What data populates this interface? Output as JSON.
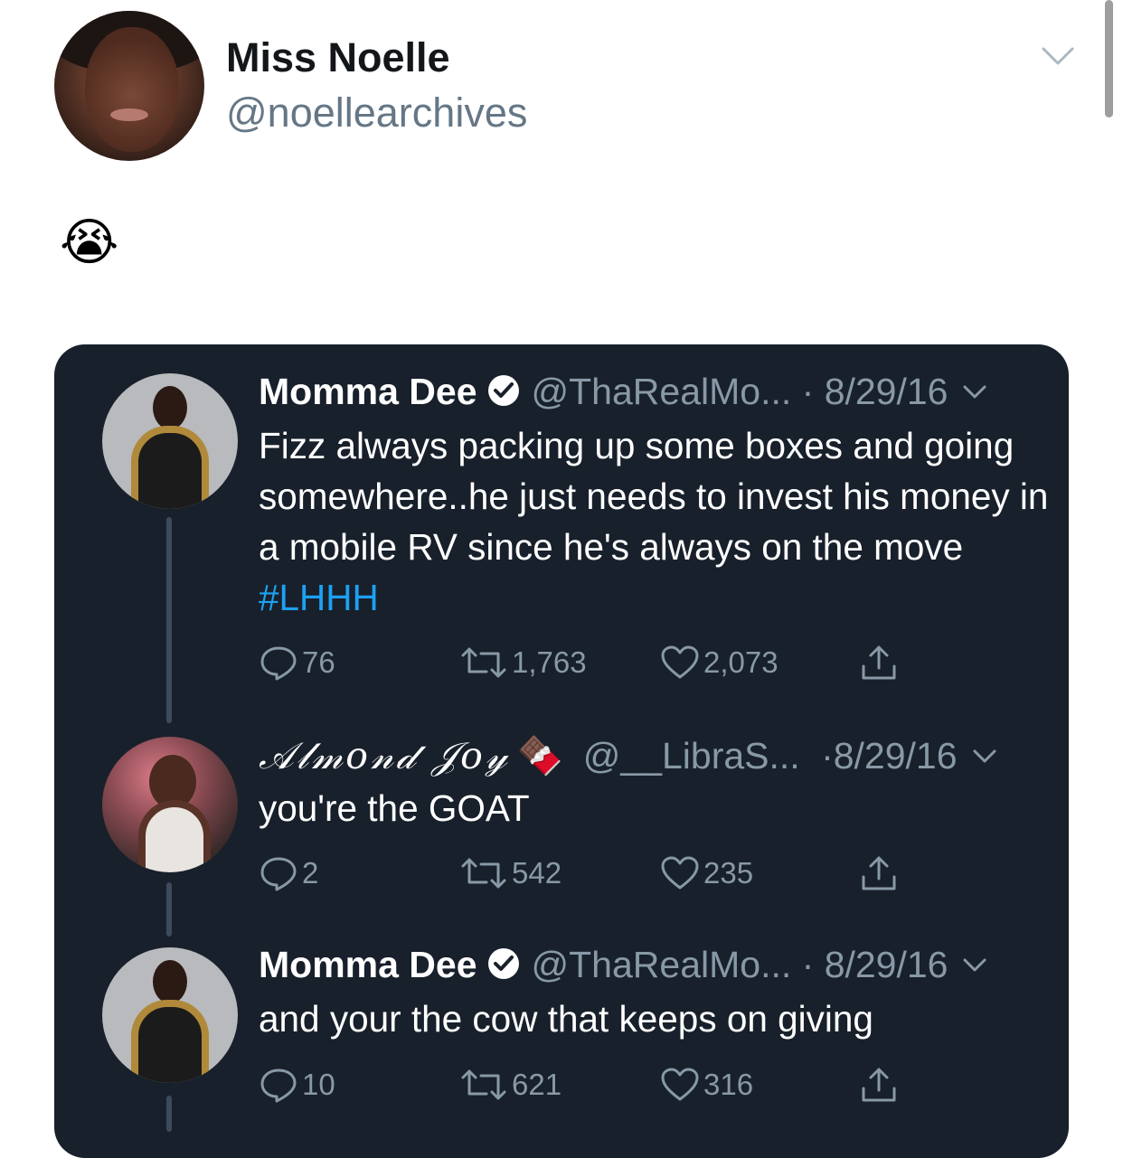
{
  "outer_tweet": {
    "display_name": "Miss Noelle",
    "handle": "@noellearchives",
    "body_emoji": "😭",
    "menu_icon": "chevron-down-icon"
  },
  "embedded_thread": [
    {
      "display_name": "Momma Dee",
      "verified": true,
      "handle": "@ThaRealMo...",
      "separator": " · ",
      "date": "8/29/16",
      "text": "Fizz always packing up some boxes and going somewhere..he just needs to invest his money in a mobile RV since he's always on the move ",
      "hashtag": "#LHHH",
      "replies": "76",
      "retweets": "1,763",
      "likes": "2,073"
    },
    {
      "display_name": "𝒜𝓁𝓂𝑜𝓃𝒹 𝒥𝑜𝓎",
      "name_emoji": "🍫",
      "verified": false,
      "handle": "@__LibraS...",
      "separator": " ·",
      "date": "8/29/16",
      "text": "you're the GOAT",
      "replies": "2",
      "retweets": "542",
      "likes": "235"
    },
    {
      "display_name": "Momma Dee",
      "verified": true,
      "handle": "@ThaRealMo...",
      "separator": " · ",
      "date": "8/29/16",
      "text": "and your the cow that keeps on giving",
      "replies": "10",
      "retweets": "621",
      "likes": "316"
    }
  ],
  "colors": {
    "card_background": "#18202b",
    "muted_text": "#8899a6",
    "hashtag": "#1da1f2",
    "verified_badge": "#ffffff"
  }
}
